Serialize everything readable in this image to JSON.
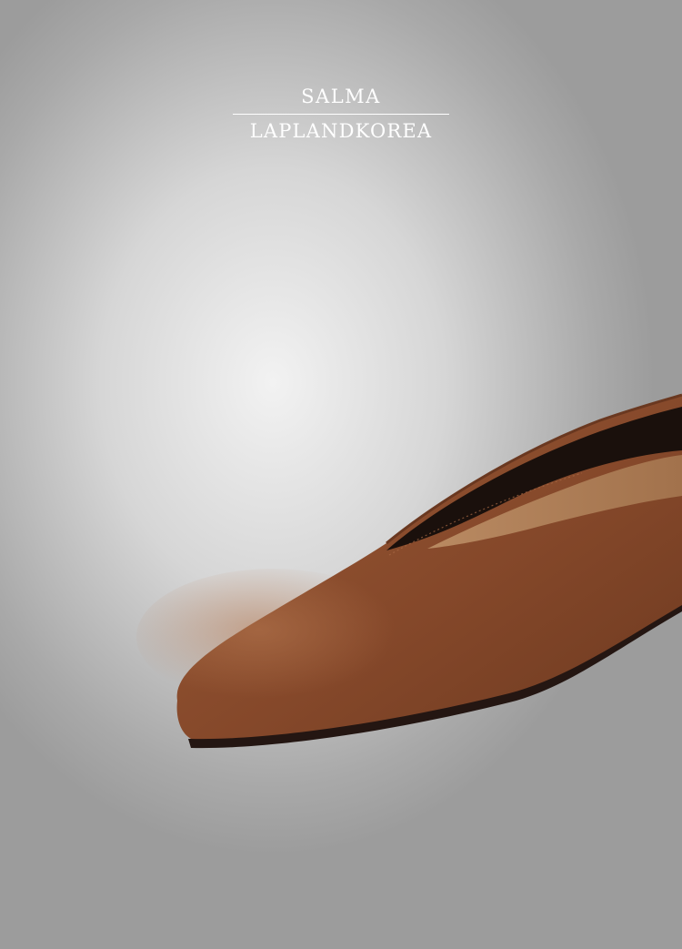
{
  "brand": {
    "name": "SALMA",
    "subtitle": "LAPLANDKOREA"
  },
  "product": {
    "icon": "shoe-illustration",
    "color": "#8a4d2c"
  }
}
